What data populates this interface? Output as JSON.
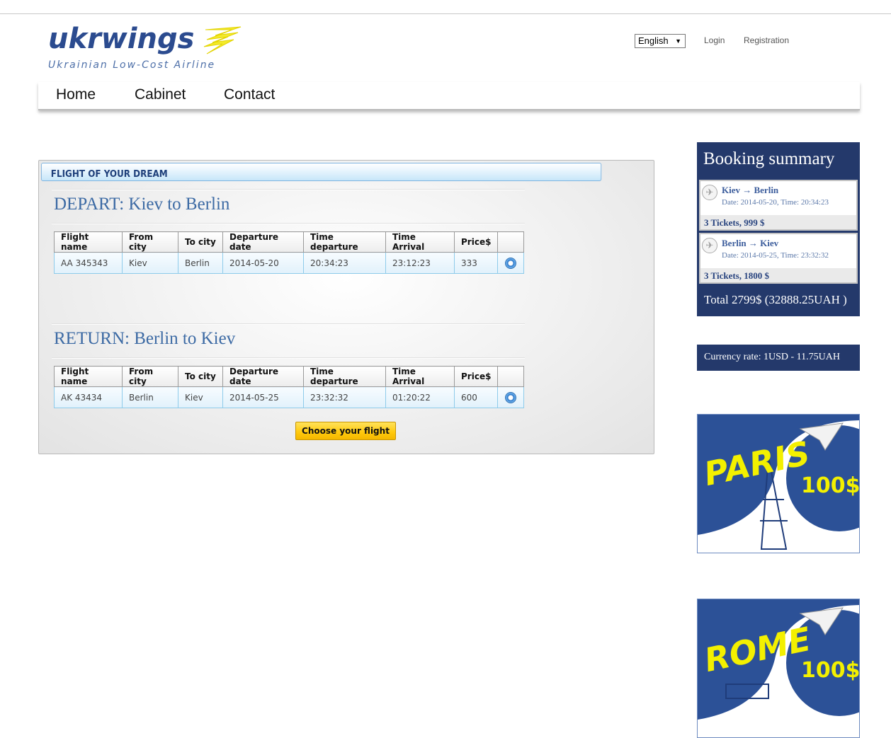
{
  "header": {
    "logo_text": "ukrwings",
    "logo_tagline": "Ukrainian Low-Cost Airline",
    "language": "English",
    "login": "Login",
    "registration": "Registration"
  },
  "nav": {
    "items": [
      "Home",
      "Cabinet",
      "Contact"
    ]
  },
  "panel": {
    "title": "FLIGHT OF YOUR DREAM",
    "depart_title": "DEPART: Kiev to Berlin",
    "return_title": "RETURN: Berlin to Kiev",
    "columns": [
      "Flight name",
      "From city",
      "To city",
      "Departure date",
      "Time departure",
      "Time Arrival",
      "Price$"
    ],
    "depart_rows": [
      [
        "AA 345343",
        "Kiev",
        "Berlin",
        "2014-05-20",
        "20:34:23",
        "23:12:23",
        "333"
      ]
    ],
    "return_rows": [
      [
        "AK 43434",
        "Berlin",
        "Kiev",
        "2014-05-25",
        "23:32:32",
        "01:20:22",
        "600"
      ]
    ],
    "choose_button": "Choose your flight"
  },
  "summary": {
    "title": "Booking summary",
    "legs": [
      {
        "route": "Kiev → Berlin",
        "details": "Date: 2014-05-20, Time: 20:34:23",
        "tickets": "3 Tickets, 999 $"
      },
      {
        "route": "Berlin → Kiev",
        "details": "Date: 2014-05-25, Time: 23:32:32",
        "tickets": "3 Tickets, 1800 $"
      }
    ],
    "total": "Total 2799$ (32888.25UAH )"
  },
  "currency": "Currency rate: 1USD - 11.75UAH",
  "promos": [
    {
      "city": "PARIS",
      "price": "100$"
    },
    {
      "city": "ROME",
      "price": "100$"
    }
  ],
  "colors": {
    "brand_blue": "#24396b",
    "accent_yellow": "#ffc80c",
    "link_blue": "#3c6aa4"
  }
}
